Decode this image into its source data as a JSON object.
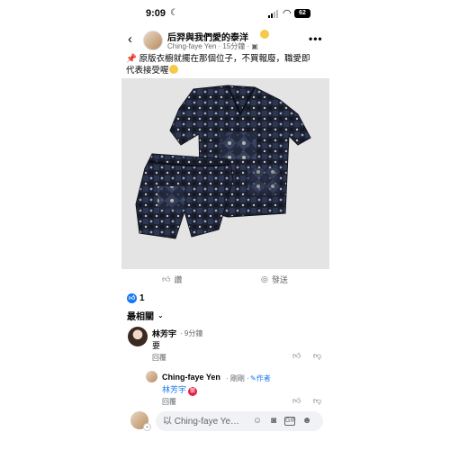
{
  "status_bar": {
    "time": "9:09",
    "battery": "62"
  },
  "header": {
    "group_name": "后羿與我們愛的泰洋",
    "author": "Ching-faye Yen",
    "time": "15分鐘"
  },
  "post": {
    "text_line1": "原版衣櫥就擺在那個位子，不買報廢，職愛即",
    "text_line2": "代表接受喔"
  },
  "actions": {
    "like_label": "讚",
    "send_label": "發送"
  },
  "reactions": {
    "count": "1"
  },
  "sort": {
    "label": "最相關"
  },
  "comments": [
    {
      "name": "林芳宇",
      "time": "9分鐘",
      "text": "要",
      "reply_label": "回覆"
    },
    {
      "name": "Ching-faye Yen",
      "time": "剛剛",
      "badge": "作者",
      "mention": "林芳宇",
      "reply_label": "回覆"
    }
  ],
  "composer": {
    "placeholder": "以 Ching-faye Ye…"
  },
  "icons": {
    "back": "chevron-left-icon",
    "more": "more-icon",
    "like": "thumbs-up-icon",
    "send": "messenger-icon",
    "camera": "camera-icon",
    "gif": "gif-icon",
    "emoji": "emoji-icon",
    "sticker": "sticker-icon"
  },
  "colors": {
    "accent": "#1877f2",
    "muted": "#65676b",
    "mention_badge": "#e41e3f"
  }
}
